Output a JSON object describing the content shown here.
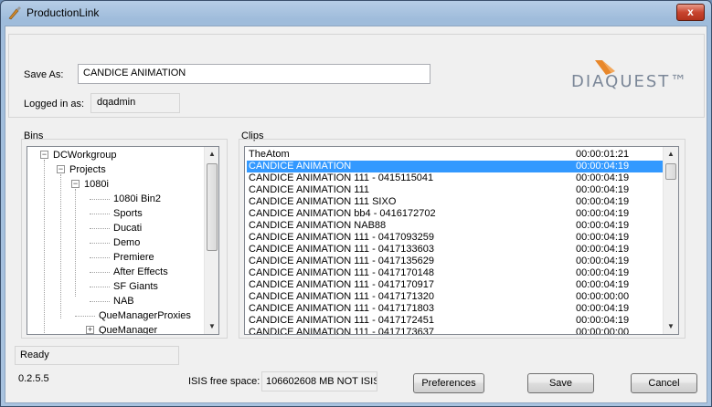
{
  "window": {
    "title": "ProductionLink",
    "close_glyph": "x"
  },
  "header": {
    "save_as_label": "Save As:",
    "save_as_value": "CANDICE ANIMATION",
    "logged_in_label": "Logged in as:",
    "logged_in_user": "dqadmin",
    "logo_text": "DIAQUEST™"
  },
  "bins": {
    "title": "Bins",
    "items": [
      {
        "label": "DCWorkgroup",
        "expander": "−"
      },
      {
        "label": "Projects",
        "expander": "−"
      },
      {
        "label": "1080i",
        "expander": "−"
      },
      {
        "label": "1080i Bin2"
      },
      {
        "label": "Sports"
      },
      {
        "label": "Ducati"
      },
      {
        "label": "Demo"
      },
      {
        "label": "Premiere"
      },
      {
        "label": "After Effects"
      },
      {
        "label": "SF Giants"
      },
      {
        "label": "NAB"
      },
      {
        "label": "QueManagerProxies"
      },
      {
        "label": "QueManager",
        "expander": "+"
      }
    ]
  },
  "clips": {
    "title": "Clips",
    "rows": [
      {
        "name": "TheAtom",
        "duration": "00:00:01:21"
      },
      {
        "name": "CANDICE ANIMATION",
        "duration": "00:00:04:19",
        "selected": true
      },
      {
        "name": "CANDICE ANIMATION 111 -  0415115041",
        "duration": "00:00:04:19"
      },
      {
        "name": "CANDICE ANIMATION 111",
        "duration": "00:00:04:19"
      },
      {
        "name": "CANDICE ANIMATION 111 SIXO",
        "duration": "00:00:04:19"
      },
      {
        "name": "CANDICE ANIMATION bb4 -  0416172702",
        "duration": "00:00:04:19"
      },
      {
        "name": "CANDICE ANIMATION NAB88",
        "duration": "00:00:04:19"
      },
      {
        "name": "CANDICE ANIMATION 111 -  0417093259",
        "duration": "00:00:04:19"
      },
      {
        "name": "CANDICE ANIMATION 111 -  0417133603",
        "duration": "00:00:04:19"
      },
      {
        "name": "CANDICE ANIMATION 111 -  0417135629",
        "duration": "00:00:04:19"
      },
      {
        "name": "CANDICE ANIMATION 111 -  0417170148",
        "duration": "00:00:04:19"
      },
      {
        "name": "CANDICE ANIMATION 111 -  0417170917",
        "duration": "00:00:04:19"
      },
      {
        "name": "CANDICE ANIMATION 111 -  0417171320",
        "duration": "00:00:00:00"
      },
      {
        "name": "CANDICE ANIMATION 111 -  0417171803",
        "duration": "00:00:04:19"
      },
      {
        "name": "CANDICE ANIMATION 111 -  0417172451",
        "duration": "00:00:04:19"
      },
      {
        "name": "CANDICE ANIMATION 111 -  0417173637",
        "duration": "00:00:00:00"
      }
    ]
  },
  "footer": {
    "status": "Ready",
    "version": "0.2.5.5",
    "isis_label": "ISIS free space:",
    "isis_value": "106602608 MB NOT ISIS",
    "preferences_label": "Preferences",
    "save_label": "Save",
    "cancel_label": "Cancel"
  },
  "scroll_glyphs": {
    "up": "▲",
    "down": "▼"
  },
  "colors": {
    "selection": "#3399ff",
    "logo_accent": "#e8872a",
    "logo_text": "#7b8798"
  }
}
